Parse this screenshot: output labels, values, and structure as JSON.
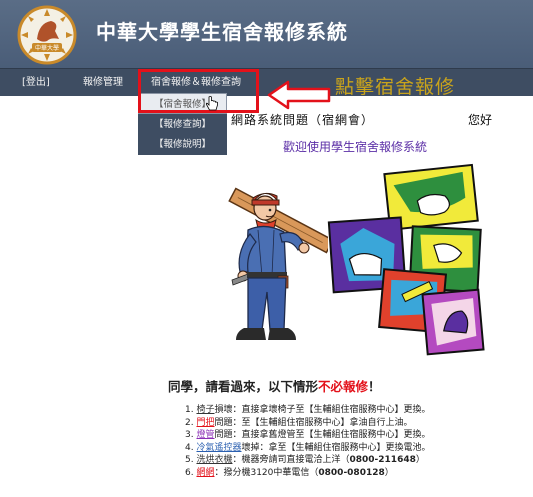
{
  "header": {
    "title": "中華大學學生宿舍報修系統",
    "logo_text": "中華大學"
  },
  "nav": {
    "logout": "[登出]",
    "manage": "報修管理",
    "dorm_menu": "宿舍報修＆報修查詢"
  },
  "dropdown": {
    "items": [
      "【宿舍報修】",
      "【報修查詢】",
      "【報修說明】"
    ]
  },
  "callout": {
    "text": "點擊宿舍報修"
  },
  "user": {
    "dorm_label": "網路系統問題（宿網會）",
    "greeting": "您好"
  },
  "welcome": "歡迎使用學生宿舍報修系統",
  "notice": {
    "title_prefix": "同學，請看過來，以下情形",
    "title_emph": "不必報修",
    "title_suffix": "！"
  },
  "rules": [
    {
      "num": "1.",
      "keyword": "椅子",
      "rest": "損壞：直接拿壞椅子至【生輔組住宿服務中心】更換。"
    },
    {
      "num": "2.",
      "keyword": "門把",
      "rest": "問題：至【生輔組住宿服務中心】拿油自行上油。"
    },
    {
      "num": "3.",
      "keyword": "燈管",
      "rest": "問題：直接拿舊燈管至【生輔組住宿服務中心】更換。"
    },
    {
      "num": "4.",
      "keyword": "冷氣遙控器",
      "rest": "壞掉：拿至【生輔組住宿服務中心】更換電池。"
    },
    {
      "num": "5.",
      "keyword": "洗烘衣機",
      "rest": "：機器旁請司直接電洽上洋（",
      "phone": "0800-211648",
      "tail": "）"
    },
    {
      "num": "6.",
      "keyword": "網網",
      "rest": "：撥分機3120中華電信（",
      "phone": "0800-080128",
      "tail": "）"
    }
  ],
  "colors": {
    "header_bg": "#4a5d78",
    "nav_bg": "#3e4d62",
    "highlight_red": "#e3111a",
    "callout_gold": "#c8a31c",
    "welcome_purple": "#5b2ea6"
  }
}
